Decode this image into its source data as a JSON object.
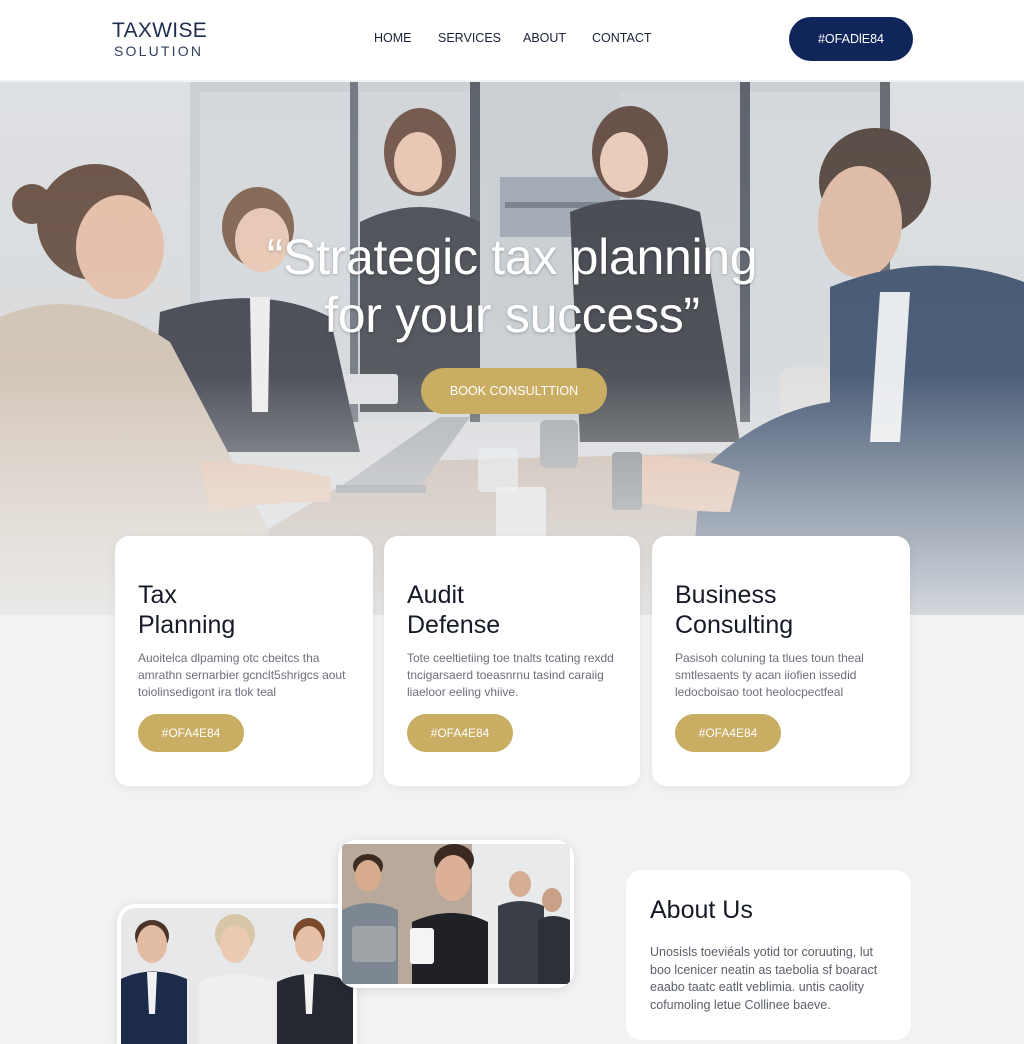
{
  "header": {
    "logo_line1": "TAXWISE",
    "logo_line2": "SOLUTION",
    "nav": [
      "HOME",
      "SERVICES",
      "ABOUT",
      "CONTACT"
    ],
    "cta_label": "#OFADlE84"
  },
  "hero": {
    "title_line1": "“Strategic tax planning",
    "title_line2": "for your success”",
    "button_label": "BOOK CONSULTTION"
  },
  "services": [
    {
      "title_line1": "Tax",
      "title_line2": "Planning",
      "text": "Auoitelca dlpaming otc cbeitcs tha amrathn sernarbier gcnclt5shrigcs aout toiolinsedigont ira tlok teal",
      "button": "#OFA4E84"
    },
    {
      "title_line1": "Audit",
      "title_line2": "Defense",
      "text": "Tote ceeltietiing toe tnalts tcating rexdd tncigarsaerd toeasnrnu tasind caraiig liaeloor eeling vhiive.",
      "button": "#OFA4E84"
    },
    {
      "title_line1": "Business",
      "title_line2": "Consulting",
      "text": "Pasisoh coluning ta tlues toun theal smtlesaents ty acan iiofien issedid ledocboisao toot heolocpectfeal",
      "button": "#OFA4E84"
    }
  ],
  "about": {
    "title": "About Us",
    "text": "Unosisls toeviéals yotid tor coruuting, lut boo lcenicer neatin as taebolia sf boaract eaabo taatc eatlt veblimia. untis caolity cofumoling letue Collinee baeve."
  },
  "colors": {
    "navy": "#10255a",
    "gold": "#c9ad63",
    "background": "#f1f2f3"
  }
}
